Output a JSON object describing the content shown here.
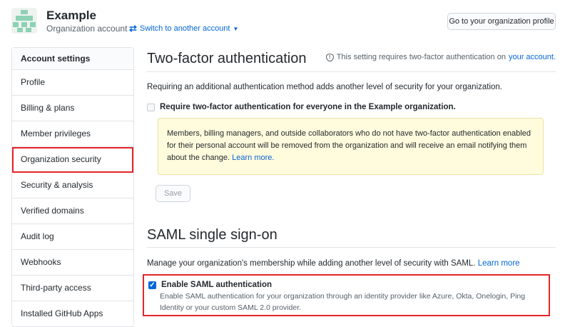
{
  "header": {
    "org_name": "Example",
    "org_type": "Organization account",
    "switch_label": "Switch to another account",
    "profile_button": "Go to your organization profile"
  },
  "sidebar": {
    "heading": "Account settings",
    "items": [
      {
        "label": "Profile"
      },
      {
        "label": "Billing & plans"
      },
      {
        "label": "Member privileges"
      },
      {
        "label": "Organization security",
        "selected": true
      },
      {
        "label": "Security & analysis"
      },
      {
        "label": "Verified domains"
      },
      {
        "label": "Audit log"
      },
      {
        "label": "Webhooks"
      },
      {
        "label": "Third-party access"
      },
      {
        "label": "Installed GitHub Apps"
      }
    ]
  },
  "two_factor": {
    "title": "Two-factor authentication",
    "notice_prefix": "This setting requires two-factor authentication on",
    "notice_link": "your account.",
    "description": "Requiring an additional authentication method adds another level of security for your organization.",
    "checkbox_label": "Require two-factor authentication for everyone in the Example organization.",
    "checkbox_checked": false,
    "warning_text": "Members, billing managers, and outside collaborators who do not have two-factor authentication enabled for their personal account will be removed from the organization and will receive an email notifying them about the change.",
    "warning_link": "Learn more.",
    "save_button": "Save"
  },
  "saml": {
    "title": "SAML single sign-on",
    "description": "Manage your organization's membership while adding another level of security with SAML.",
    "description_link": "Learn more",
    "checkbox_label": "Enable SAML authentication",
    "checkbox_checked": true,
    "note": "Enable SAML authentication for your organization through an identity provider like Azure, Okta, Onelogin, Ping Identity or your custom SAML 2.0 provider."
  },
  "colors": {
    "link": "#0366d6",
    "highlight_border": "#e5252a",
    "warning_bg": "#fffbdd",
    "avatar_green": "#8ed1b5"
  }
}
